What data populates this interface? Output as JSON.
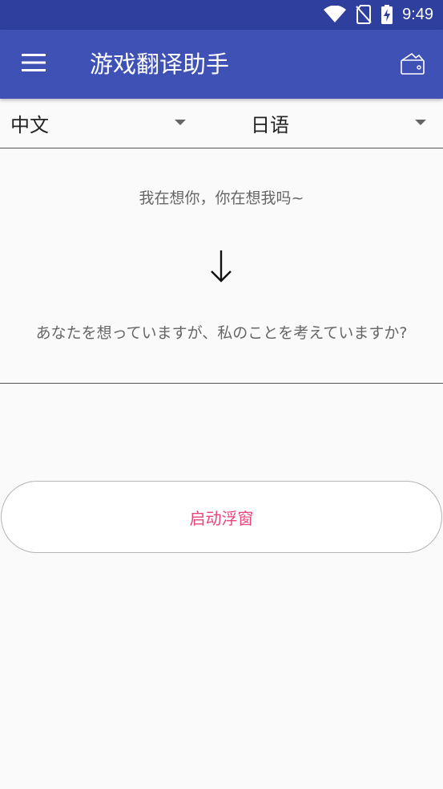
{
  "status_bar": {
    "time": "9:49",
    "icons": [
      "wifi-icon",
      "no-sim-icon",
      "battery-charging-icon"
    ]
  },
  "app_bar": {
    "title": "游戏翻译助手",
    "menu_icon": "menu-icon",
    "action_icon": "wallet-icon"
  },
  "language_selector": {
    "source_language": "中文",
    "target_language": "日语",
    "dropdown_icon": "dropdown-arrow-icon"
  },
  "translation": {
    "source_text": "我在想你，你在想我吗~",
    "arrow_icon": "arrow-down-icon",
    "translated_text": "あなたを想っていますが、私のことを考えていますか?"
  },
  "actions": {
    "start_float_window_label": "启动浮窗"
  },
  "colors": {
    "status_bar": "#2f3f9e",
    "app_bar": "#3f51b5",
    "accent_text": "#e8467a",
    "background": "#fafafa"
  }
}
